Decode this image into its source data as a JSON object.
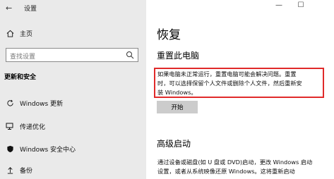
{
  "window": {
    "title": "设置",
    "back_glyph": "←",
    "controls": {
      "minimize": "—",
      "maximize": "☐"
    }
  },
  "sidebar": {
    "home_label": "主页",
    "search_placeholder": "查找设置",
    "section_title": "更新和安全",
    "items": [
      {
        "label": "Windows 更新",
        "icon": "refresh-icon"
      },
      {
        "label": "传递优化",
        "icon": "delivery-optimization-icon"
      },
      {
        "label": "Windows 安全中心",
        "icon": "shield-icon"
      },
      {
        "label": "备份",
        "icon": "backup-upload-icon"
      }
    ]
  },
  "main": {
    "page_title": "恢复",
    "reset": {
      "heading": "重置此电脑",
      "description_lines": [
        "如果电脑未正常运行，重置电脑可能会解决问题。重置",
        "时，可以选择保留个人文件或删除个人文件，然后重新安",
        "装 Windows。"
      ],
      "button_label": "开始"
    },
    "advanced": {
      "heading": "高级启动",
      "description_lines": [
        "通过设备或磁盘(如 U 盘或 DVD)启动，更改 Windows 启动",
        "设置，或者从系统映像还原 Windows。这将重新启动"
      ]
    }
  },
  "colors": {
    "sidebar_bg": "#eaeaea",
    "highlight_border": "#e02a2a",
    "button_bg": "#cccccc"
  }
}
